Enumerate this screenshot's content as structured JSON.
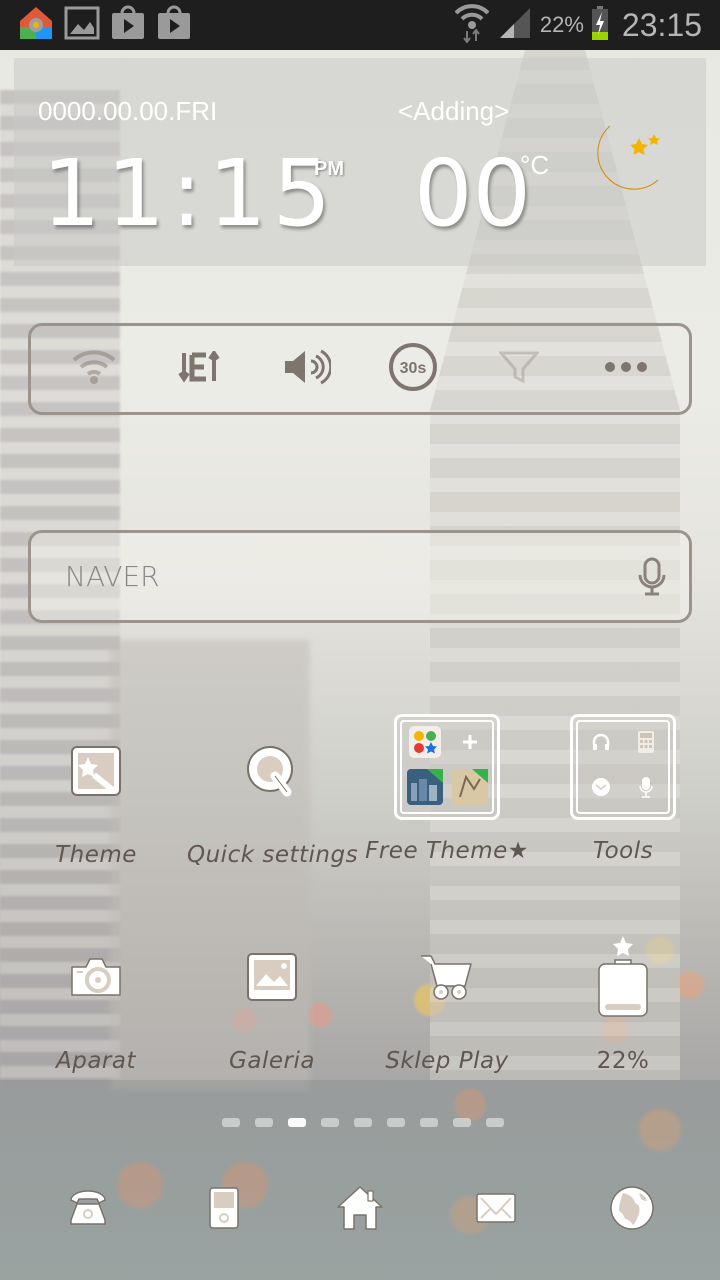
{
  "status_bar": {
    "notification_icons": [
      "launcher-theme-icon",
      "gallery-image-icon",
      "play-store-icon",
      "play-store-icon"
    ],
    "wifi": "wifi-data-icon",
    "signal": "cell-signal-icon",
    "battery_percent": "22%",
    "battery_state": "charging",
    "time": "23:15"
  },
  "clock_widget": {
    "date": "0000.00.00.FRI",
    "location": "<Adding>",
    "time": "11:15",
    "ampm": "PM",
    "temperature": "00",
    "unit": "°C",
    "weather_icon": "moon-stars-icon"
  },
  "quick_toggles": [
    {
      "name": "wifi-toggle",
      "icon": "wifi-icon",
      "state": "off"
    },
    {
      "name": "data-toggle",
      "icon": "data-transfer-icon",
      "state": "on"
    },
    {
      "name": "sound-toggle",
      "icon": "volume-icon",
      "state": "on"
    },
    {
      "name": "screen-timeout-toggle",
      "icon": "timer-icon",
      "label": "30s"
    },
    {
      "name": "brightness-toggle",
      "icon": "filter-icon",
      "state": "off"
    },
    {
      "name": "more-toggle",
      "icon": "more-dots-icon"
    }
  ],
  "search": {
    "placeholder": "NAVER",
    "voice_icon": "mic-icon"
  },
  "apps_row1": [
    {
      "label": "Theme",
      "icon": "magic-wand-icon"
    },
    {
      "label": "Quick settings",
      "icon": "quick-q-icon"
    },
    {
      "label": "Free Theme★",
      "icon": "folder-icon"
    },
    {
      "label": "Tools",
      "icon": "folder-icon"
    }
  ],
  "apps_row2": [
    {
      "label": "Aparat",
      "icon": "camera-icon"
    },
    {
      "label": "Galeria",
      "icon": "gallery-icon"
    },
    {
      "label": "Sklep Play",
      "icon": "shopping-cart-icon"
    },
    {
      "label": "22%",
      "icon": "battery-widget-icon"
    }
  ],
  "battery_widget": {
    "level_percent": 22
  },
  "page_indicator": {
    "total": 9,
    "active_index": 2
  },
  "dock": [
    {
      "name": "phone",
      "icon": "phone-icon"
    },
    {
      "name": "music-player",
      "icon": "music-player-icon"
    },
    {
      "name": "home",
      "icon": "home-icon"
    },
    {
      "name": "messages",
      "icon": "mail-icon"
    },
    {
      "name": "browser",
      "icon": "globe-icon"
    }
  ],
  "colors": {
    "status_bar_bg": "#1e1e1e",
    "outline": "#9c948c",
    "label_text": "#5f5650",
    "icon_fill": "#ffffff",
    "icon_inner": "#d8cdc0"
  }
}
